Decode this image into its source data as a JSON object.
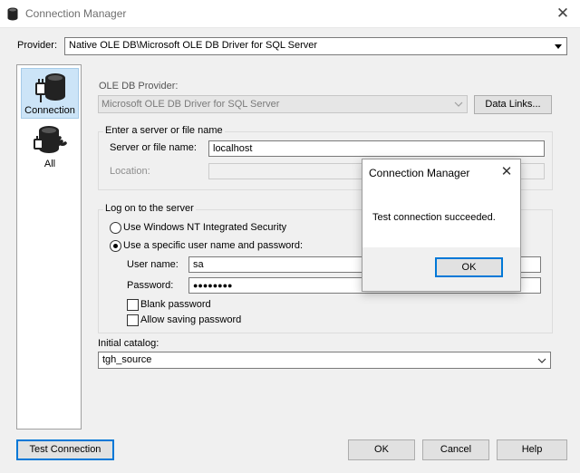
{
  "window": {
    "title": "Connection Manager",
    "close_glyph": "✕"
  },
  "provider": {
    "label": "Provider:",
    "value": "Native OLE DB\\Microsoft OLE DB Driver for SQL Server"
  },
  "nav": {
    "items": [
      {
        "label": "Connection",
        "icon": "database-plug-icon",
        "selected": true
      },
      {
        "label": "All",
        "icon": "database-wrench-icon",
        "selected": false
      }
    ]
  },
  "oledb": {
    "label": "OLE DB Provider:",
    "value": "Microsoft OLE DB Driver for SQL Server",
    "data_links_label": "Data Links..."
  },
  "server_group": {
    "title": "Enter a server or file name",
    "server_label": "Server or file name:",
    "server_value": "localhost",
    "location_label": "Location:",
    "location_value": ""
  },
  "logon_group": {
    "title": "Log on to the server",
    "radio_windows": "Use Windows NT Integrated Security",
    "radio_specific": "Use a specific user name and password:",
    "selected_radio": "specific",
    "username_label": "User name:",
    "username_value": "sa",
    "password_label": "Password:",
    "password_value": "●●●●●●●●",
    "blank_password_label": "Blank password",
    "blank_password_checked": false,
    "allow_saving_label": "Allow saving password",
    "allow_saving_checked": false
  },
  "catalog": {
    "label": "Initial catalog:",
    "value": "tgh_source"
  },
  "buttons": {
    "test_connection": "Test Connection",
    "ok": "OK",
    "cancel": "Cancel",
    "help": "Help"
  },
  "message_box": {
    "title": "Connection Manager",
    "close_glyph": "✕",
    "text": "Test connection succeeded.",
    "ok": "OK"
  },
  "colors": {
    "accent": "#0078d7",
    "selection": "#cce4f7",
    "window_bg": "#f0f0f0"
  }
}
